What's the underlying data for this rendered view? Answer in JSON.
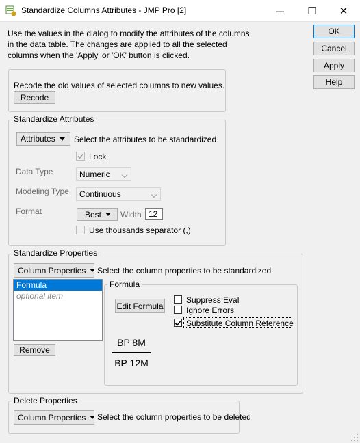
{
  "window": {
    "title": "Standardize Columns Attributes - JMP Pro [2]",
    "minimize_glyph": "—",
    "maximize_glyph": "☐",
    "close_glyph": "✕"
  },
  "intro": {
    "line1": "Use the values in the dialog to modify the attributes of the columns",
    "line2": "in the data table. The changes are applied to all the selected",
    "line3": "columns when the 'Apply' or 'OK' button is clicked."
  },
  "buttons": {
    "ok": "OK",
    "cancel": "Cancel",
    "apply": "Apply",
    "help": "Help"
  },
  "recode": {
    "text": "Recode the old values of selected columns to new values.",
    "button": "Recode"
  },
  "attributes": {
    "legend": "Standardize Attributes",
    "dropdown": "Attributes",
    "hint": "Select the attributes to be standardized",
    "lock_label": "Lock",
    "lock_checked": true,
    "data_type_label": "Data Type",
    "data_type_value": "Numeric",
    "modeling_type_label": "Modeling Type",
    "modeling_type_value": "Continuous",
    "format_label": "Format",
    "format_value": "Best",
    "width_label": "Width",
    "width_value": "12",
    "thousands_label": "Use thousands separator (,)",
    "thousands_checked": false
  },
  "properties": {
    "legend": "Standardize Properties",
    "dropdown": "Column Properties",
    "hint": "Select the column properties to be standardized",
    "list_items": [
      "Formula",
      "optional item"
    ],
    "remove_button": "Remove",
    "formula_legend": "Formula",
    "edit_formula_button": "Edit Formula",
    "suppress_eval_label": "Suppress Eval",
    "suppress_eval_checked": false,
    "ignore_errors_label": "Ignore Errors",
    "ignore_errors_checked": false,
    "substitute_label": "Substitute Column Reference",
    "substitute_checked": true,
    "formula_numerator": "BP 8M",
    "formula_denominator": "BP 12M"
  },
  "delete": {
    "legend": "Delete Properties",
    "dropdown": "Column Properties",
    "hint": "Select the column properties to be deleted"
  },
  "colors": {
    "selection": "#0078d7",
    "accent_icon": "#2e8b57"
  }
}
